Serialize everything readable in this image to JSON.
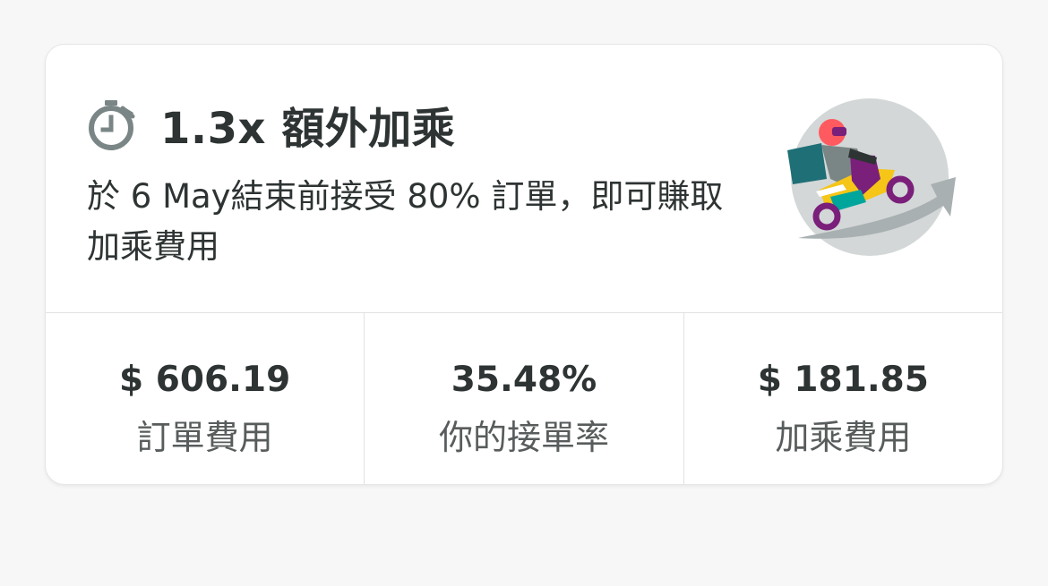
{
  "card": {
    "title": "1.3x 額外加乘",
    "description": "於 6 May結束前接受 80% 訂單，即可賺取加乘費用",
    "icon": "stopwatch-icon",
    "illustration": "delivery-rider-illustration"
  },
  "stats": [
    {
      "value": "$ 606.19",
      "label": "訂單費用"
    },
    {
      "value": "35.48%",
      "label": "你的接單率"
    },
    {
      "value": "$ 181.85",
      "label": "加乘費用"
    }
  ],
  "colors": {
    "text_primary": "#2e3333",
    "text_secondary": "#585c5c",
    "icon_gray": "#7a8585",
    "rider_teal": "#00a59c",
    "rider_yellow": "#f5c518",
    "rider_purple": "#7a1f7a",
    "rider_red": "#ff5a5f"
  }
}
